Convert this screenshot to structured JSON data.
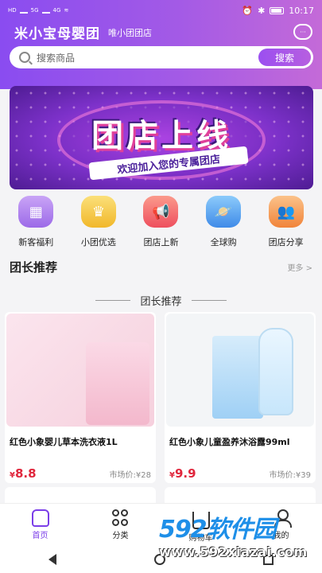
{
  "status_bar": {
    "time": "10:17",
    "left_labels": [
      "HD",
      "5G",
      "4G"
    ]
  },
  "header": {
    "app_title": "米小宝母婴团",
    "shop_name": "唯小团团店",
    "search": {
      "placeholder": "搜索商品",
      "button": "搜索"
    },
    "chat_icon": "chat-bubble-icon"
  },
  "banner": {
    "headline": "团店上线",
    "subtitle": "欢迎加入您的专属团店"
  },
  "categories": [
    {
      "label": "新客福利",
      "icon": "shop-icon",
      "color": "#b98af0"
    },
    {
      "label": "小团优选",
      "icon": "crown-icon",
      "color": "#f5c94a"
    },
    {
      "label": "团店上新",
      "icon": "megaphone-icon",
      "color": "#f36b6b"
    },
    {
      "label": "全球购",
      "icon": "planet-icon",
      "color": "#5aa6f2"
    },
    {
      "label": "团店分享",
      "icon": "people-icon",
      "color": "#f4a25a"
    }
  ],
  "section": {
    "title": "团长推荐",
    "more": "更多 >",
    "divider_title": "团长推荐"
  },
  "products": [
    {
      "name": "红色小象婴儿草本洗衣液1L",
      "currency": "¥",
      "price": "8.8",
      "market_price": "市场价:¥28"
    },
    {
      "name": "红色小象儿童盈养沐浴露99ml",
      "currency": "¥",
      "price": "9.9",
      "market_price": "市场价:¥39"
    }
  ],
  "tabbar": [
    {
      "label": "首页",
      "icon": "home-icon",
      "active": true
    },
    {
      "label": "分类",
      "icon": "category-icon",
      "active": false
    },
    {
      "label": "购物车",
      "icon": "cart-icon",
      "active": false
    },
    {
      "label": "我的",
      "icon": "user-icon",
      "active": false
    }
  ],
  "watermark": {
    "main": "592软件园",
    "url": "www.592xiazai.com"
  },
  "colors": {
    "accent": "#8a4cf0",
    "price": "#e0263c"
  }
}
